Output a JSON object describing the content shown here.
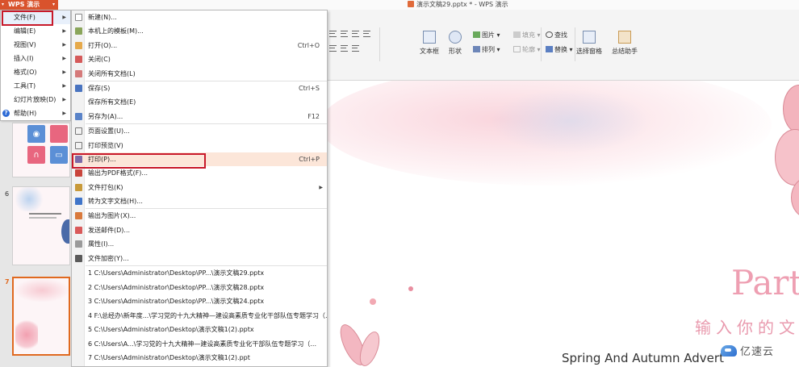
{
  "window": {
    "app_button": "WPS 演示",
    "title": "演示文稿29.pptx * - WPS 演示"
  },
  "ribbon": {
    "text_box": "文本框",
    "shape": "形状",
    "picture": "图片",
    "fill": "填充",
    "arrange": "排列",
    "outline": "轮廓",
    "find": "查找",
    "replace": "替换",
    "selection_pane": "选择窗格",
    "summary_assistant": "总结助手"
  },
  "main_menu": {
    "items": [
      {
        "label": "文件(F)",
        "has_sub": true
      },
      {
        "label": "编辑(E)",
        "has_sub": true
      },
      {
        "label": "视图(V)",
        "has_sub": true
      },
      {
        "label": "插入(I)",
        "has_sub": true
      },
      {
        "label": "格式(O)",
        "has_sub": true
      },
      {
        "label": "工具(T)",
        "has_sub": true
      },
      {
        "label": "幻灯片放映(D)",
        "has_sub": true
      },
      {
        "label": "帮助(H)",
        "has_sub": true
      }
    ]
  },
  "file_menu": {
    "new": "新建(N)...",
    "local_templates": "本机上的模板(M)...",
    "open": "打开(O)...",
    "open_shortcut": "Ctrl+O",
    "close": "关闭(C)",
    "close_all": "关闭所有文档(L)",
    "save": "保存(S)",
    "save_shortcut": "Ctrl+S",
    "save_all": "保存所有文档(E)",
    "save_as": "另存为(A)...",
    "save_as_shortcut": "F12",
    "page_setup": "页面设置(U)...",
    "print_preview": "打印预览(V)",
    "print": "打印(P)...",
    "print_shortcut": "Ctrl+P",
    "export_pdf": "输出为PDF格式(F)...",
    "package": "文件打包(K)",
    "to_text": "转为文字文档(H)...",
    "export_image": "输出为图片(X)...",
    "send_mail": "发送邮件(D)...",
    "properties": "属性(I)...",
    "encrypt": "文件加密(Y)...",
    "recent": [
      "1 C:\\Users\\Administrator\\Desktop\\PP...\\演示文稿29.pptx",
      "2 C:\\Users\\Administrator\\Desktop\\PP...\\演示文稿28.pptx",
      "3 C:\\Users\\Administrator\\Desktop\\PP...\\演示文稿24.pptx",
      "4 F:\\总经办\\新年度...\\学习党的十九大精神—建设高素质专业化干部队伍专题学习（...",
      "5 C:\\Users\\Administrator\\Desktop\\演示文稿1(2).pptx",
      "6 C:\\Users\\A...\\学习党的十九大精神—建设高素质专业化干部队伍专题学习（...",
      "7 C:\\Users\\Administrator\\Desktop\\演示文稿1(2).ppt"
    ]
  },
  "slides_panel": {
    "numbers": [
      "6",
      "7"
    ]
  },
  "slide": {
    "heading": "Part",
    "chinese_line": "输入你的文",
    "english_line": "Spring And Autumn Advert"
  },
  "watermark": "亿速云",
  "colors": {
    "wps_orange": "#d9532c",
    "highlight_red": "#c8192a",
    "selected_bg": "#fce6d9",
    "accent_pink": "#ee9fb2"
  }
}
